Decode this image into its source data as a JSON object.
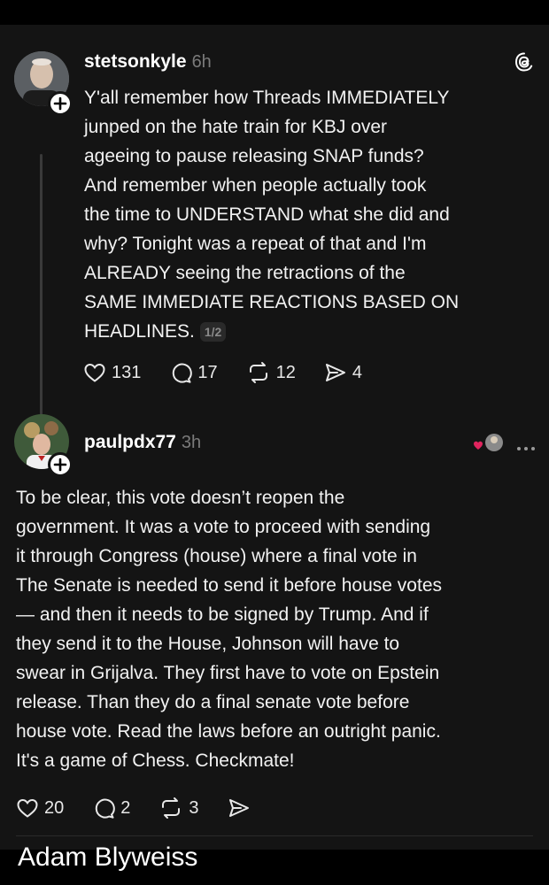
{
  "post1": {
    "username": "stetsonkyle",
    "time": "6h",
    "text": "Y'all remember how Threads IMMEDIATELY\njunped on the hate train for KBJ over\nageeing to pause releasing SNAP funds?\nAnd remember when people actually took\nthe time to UNDERSTAND what she did and\nwhy? Tonight was a repeat of that and I'm\nALREADY seeing the retractions of the\nSAME IMMEDIATE REACTIONS BASED ON\nHEADLINES.",
    "pager": "1/2",
    "likes": "131",
    "replies": "17",
    "reposts": "12",
    "shares": "4"
  },
  "post2": {
    "username": "paulpdx77",
    "time": "3h",
    "text": "To be clear, this vote doesn’t reopen the\ngovernment. It was a vote to proceed with sending\nit through Congress (house) where a final vote in\nThe Senate is needed to send it before house votes\n— and then it needs to be signed by Trump. And if\nthey send it to the House, Johnson will have to\nswear in Grijalva. They first have to vote on Epstein\nrelease. Than they do a final senate vote before\nhouse vote. Read the laws before an outright panic.\nIt's a game of Chess. Checkmate!",
    "likes": "20",
    "replies": "2",
    "reposts": "3"
  },
  "caption": "Adam Blyweiss",
  "icons": [
    "threads-logo-icon",
    "plus-icon",
    "heart-icon",
    "comment-icon",
    "repost-icon",
    "share-icon",
    "liked-by-icon",
    "more-icon"
  ]
}
